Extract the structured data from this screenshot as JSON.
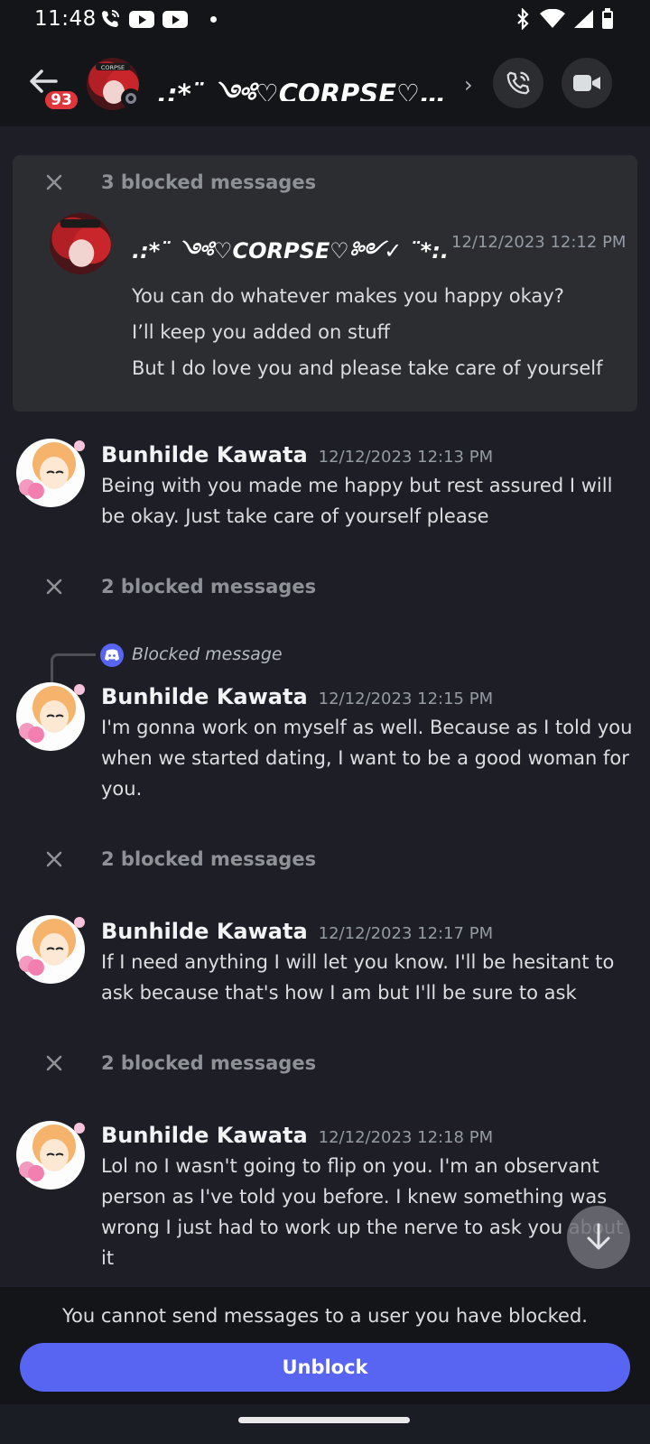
{
  "status_bar": {
    "time": "11:48"
  },
  "header": {
    "unread_badge": "93",
    "channel_name": ".:*¨ ༺♡CORPSE♡…",
    "avatar_label": "CORPSE"
  },
  "expanded_block": {
    "count_label": "3 blocked messages",
    "author": ".:*¨ ༺♡CORPSE♡༻✓ ¨*:.",
    "timestamp": "12/12/2023 12:12 PM",
    "lines": [
      "You can do whatever makes you happy okay?",
      "I’ll keep you added on stuff",
      "But I do love you and please take care of yourself"
    ]
  },
  "messages": [
    {
      "author": "Bunhilde Kawata",
      "timestamp": "12/12/2023 12:13 PM",
      "text": "Being with you made me happy but rest assured I will be okay. Just take care of yourself please"
    },
    {
      "author": "Bunhilde Kawata",
      "timestamp": "12/12/2023 12:15 PM",
      "text": "I'm gonna work on myself as well. Because as I told you when we started dating, I want to be a good woman for you."
    },
    {
      "author": "Bunhilde Kawata",
      "timestamp": "12/12/2023 12:17 PM",
      "text": "If I need anything I will let you know.  I'll be hesitant to ask because that's how I am but I'll be sure to ask"
    },
    {
      "author": "Bunhilde Kawata",
      "timestamp": "12/12/2023 12:18 PM",
      "text": "Lol no I wasn't going to flip on you. I'm an observant person as I've told you before. I knew something was wrong I just had to work up the nerve to ask you about it"
    }
  ],
  "blocked_groups": [
    "2 blocked messages",
    "2 blocked messages",
    "2 blocked messages"
  ],
  "reply_preview": "Blocked message",
  "footer": {
    "note": "You cannot send messages to a user you have blocked.",
    "unblock_label": "Unblock"
  },
  "colors": {
    "accent": "#5865f2",
    "badge": "#e1353c",
    "background": "#1e1f26"
  }
}
